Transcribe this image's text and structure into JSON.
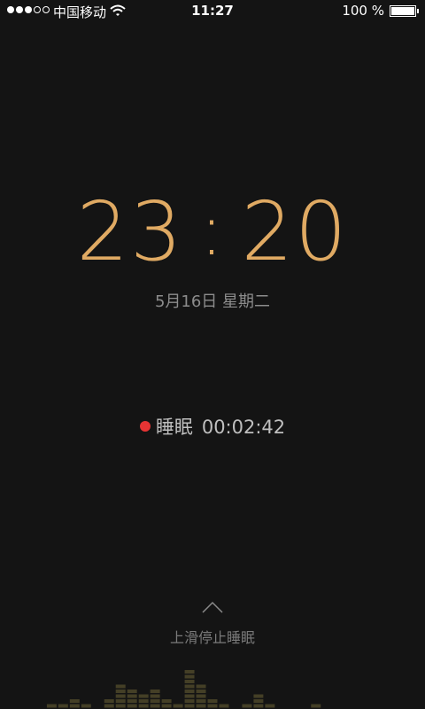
{
  "status_bar": {
    "signal_full": 3,
    "signal_empty": 2,
    "carrier": "中国移动",
    "time": "11:27",
    "battery_percent": "100 %",
    "battery_level": 1.0
  },
  "clock": {
    "hours": "23",
    "separator": ":",
    "minutes": "20",
    "date": "5月16日 星期二",
    "color": "#e0aa63"
  },
  "sleep": {
    "indicator_color": "#e73434",
    "label": "睡眠",
    "elapsed": "00:02:42"
  },
  "swipe": {
    "icon": "chevron-up-icon",
    "hint": "上滑停止睡眠"
  },
  "equalizer": {
    "levels": [
      0,
      0,
      0,
      0,
      1,
      1,
      2,
      1,
      0,
      2,
      5,
      4,
      3,
      4,
      2,
      1,
      8,
      5,
      2,
      1,
      0,
      1,
      3,
      1,
      0,
      0,
      0,
      1,
      0,
      0,
      0,
      0,
      0,
      0,
      0,
      0,
      0
    ],
    "color": "#6b6235"
  }
}
